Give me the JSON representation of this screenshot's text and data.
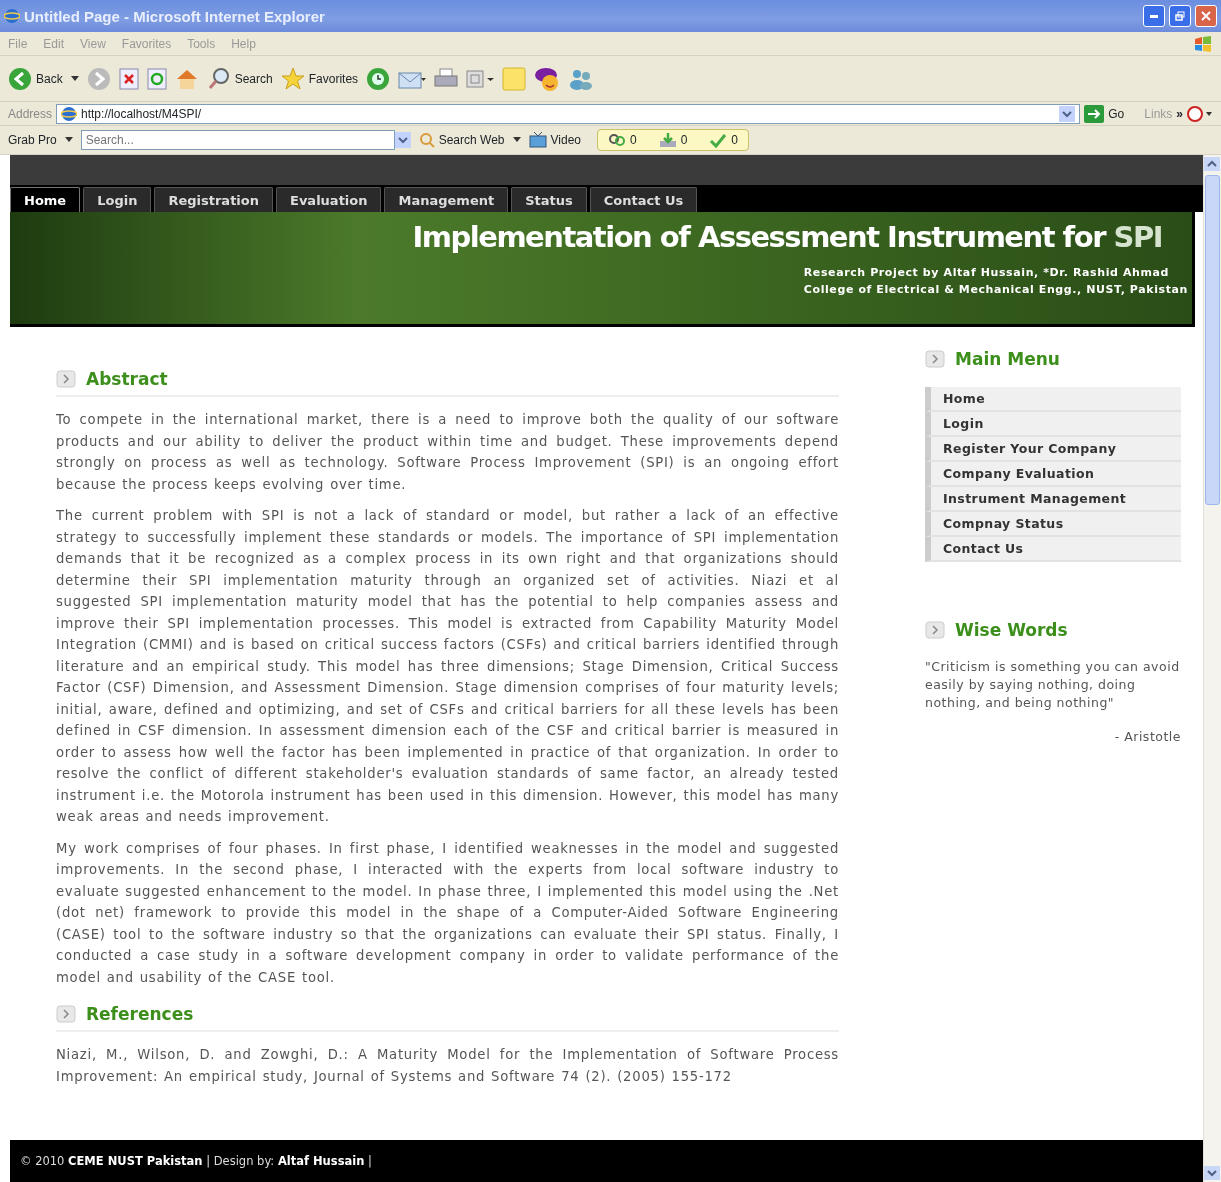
{
  "window": {
    "title": "Untitled Page - Microsoft Internet Explorer"
  },
  "menu_bar": [
    "File",
    "Edit",
    "View",
    "Favorites",
    "Tools",
    "Help"
  ],
  "toolbar": [
    {
      "kind": "back",
      "label": "Back"
    },
    {
      "kind": "search",
      "label": "Search"
    },
    {
      "kind": "favorites",
      "label": "Favorites"
    }
  ],
  "address_bar": {
    "label": "Address",
    "value": "http://localhost/M4SPI/",
    "go": "Go",
    "links": "Links",
    "chevron": "»"
  },
  "grab_toolbar": {
    "label": "Grab Pro",
    "placeholder": "Search...",
    "search_web": "Search Web",
    "video": "Video",
    "counters": [
      "0",
      "0",
      "0"
    ]
  },
  "nav_tabs": [
    {
      "label": "Home",
      "selected": true
    },
    {
      "label": "Login",
      "selected": false
    },
    {
      "label": "Registration",
      "selected": false
    },
    {
      "label": "Evaluation",
      "selected": false
    },
    {
      "label": "Management",
      "selected": false
    },
    {
      "label": "Status",
      "selected": false
    },
    {
      "label": "Contact Us",
      "selected": false
    }
  ],
  "banner": {
    "title": "Implementation of Assessment Instrument for",
    "title_highlight": "SPI",
    "subtitle_lines": [
      "Research Project by Altaf Hussain, *Dr. Rashid Ahmad",
      "College of Electrical & Mechanical Engg., NUST, Pakistan"
    ]
  },
  "sections": [
    {
      "heading": "Abstract",
      "paragraphs": [
        "To compete in the international market, there is a need to improve both the quality of our software products and our ability to deliver the product within time and budget. These improvements depend strongly on process as well as technology. Software Process Improvement (SPI) is an ongoing effort because the process keeps evolving over time.",
        "The current problem with SPI is not a lack of standard or model, but rather a lack of an effective strategy to successfully implement these standards or models. The importance of SPI implementation demands that it be recognized as a complex process in its own right and that organizations should determine their SPI implementation maturity through an organized set of activities. Niazi et al suggested SPI implementation maturity model that has the potential to help companies assess and improve their SPI implementation processes. This model is extracted from Capability Maturity Model Integration (CMMI) and is based on critical success factors (CSFs) and critical barriers identified through literature and an empirical study. This model has three dimensions; Stage Dimension, Critical Success Factor (CSF) Dimension, and Assessment Dimension. Stage dimension comprises of four maturity levels; initial, aware, defined and optimizing, and set of CSFs and critical barriers for all these levels has been defined in CSF dimension. In assessment dimension each of the CSF and critical barrier is measured in order to assess how well the factor has been implemented in practice of that organization. In order to resolve the conflict of different stakeholder's evaluation standards of same factor, an already tested instrument i.e. the Motorola instrument has been used in this dimension. However, this model has many weak areas and needs improvement.",
        "My work comprises of four phases. In first phase, I identified weaknesses in the model and suggested improvements. In the second phase, I interacted with the experts from local software industry to evaluate suggested enhancement to the model. In phase three, I implemented this model using the .Net (dot net) framework to provide this model in the shape of a Computer-Aided Software Engineering (CASE) tool to the software industry so that the organizations can evaluate their SPI status. Finally, I conducted a case study in a software development company in order to validate performance of the model and usability of the CASE tool."
      ]
    },
    {
      "heading": "References",
      "paragraphs": [
        "Niazi, M., Wilson, D. and Zowghi, D.: A Maturity Model for the Implementation of Software Process Improvement: An empirical study, Journal of Systems and Software 74 (2). (2005) 155-172"
      ]
    }
  ],
  "sidebar": {
    "main_menu": {
      "heading": "Main Menu",
      "items": [
        "Home",
        "Login",
        "Register Your Company",
        "Company Evaluation",
        "Instrument Management",
        "Compnay Status",
        "Contact Us"
      ]
    },
    "wise_words": {
      "heading": "Wise Words",
      "quote": "\"Criticism is something you can avoid easily by saying nothing, doing nothing, and being nothing\"",
      "author": "- Aristotle"
    }
  },
  "footer": {
    "text": "© 2010 **CEME NUST Pakistan** | Design by: **Altaf Hussain** |"
  }
}
